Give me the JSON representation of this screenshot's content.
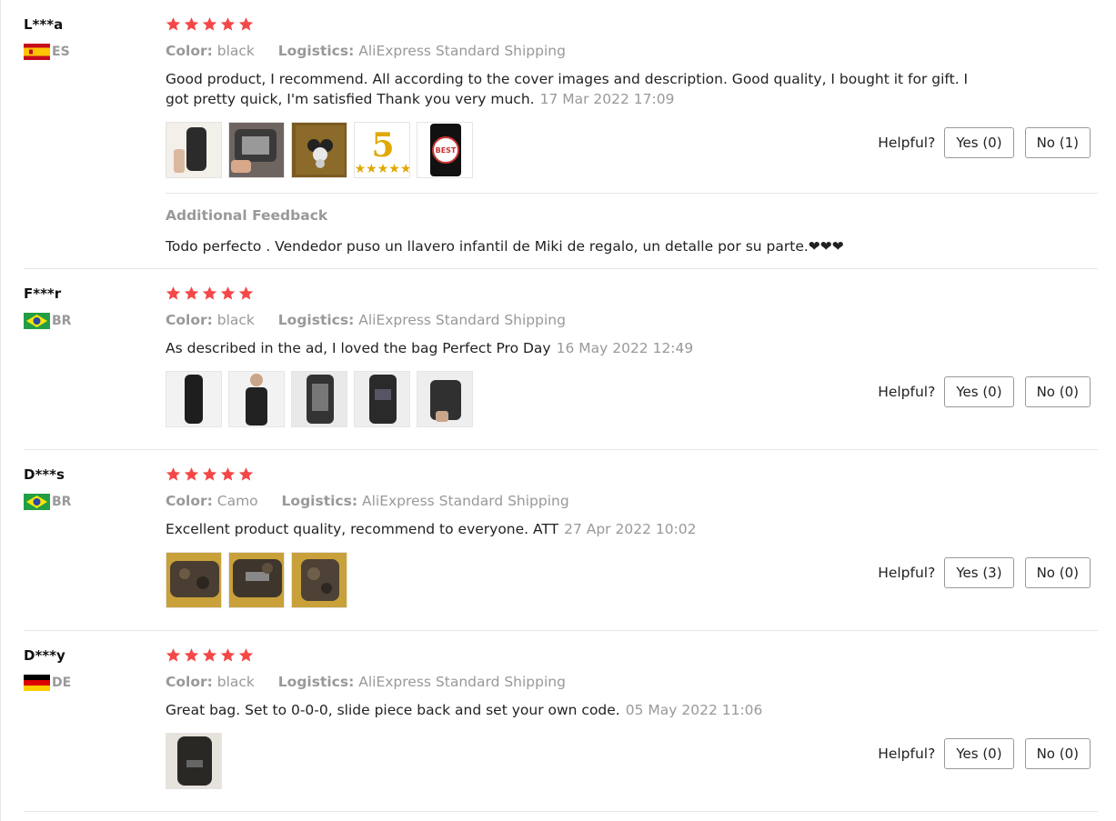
{
  "helpful_label": "Helpful?",
  "labels": {
    "color": "Color:",
    "logistics": "Logistics:"
  },
  "colors": {
    "star": "#f44848",
    "muted": "#999999",
    "text": "#222222",
    "divider": "#e6e6e6"
  },
  "reviews": [
    {
      "user": "L***a",
      "country": "ES",
      "flag": "spain-flag-icon",
      "rating": 5,
      "color": "black",
      "logistics": "AliExpress Standard Shipping",
      "text": "Good product, I recommend. All according to the cover images and description. Good quality, I bought it for gift. I got pretty quick, I'm satisfied Thank you very much.",
      "date": "17 Mar 2022 17:09",
      "photos": 5,
      "yes": "Yes (0)",
      "no": "No (1)",
      "additional_feedback": {
        "title": "Additional Feedback",
        "text": "Todo perfecto . Vendedor puso un llavero infantil de Miki de regalo, un detalle por su parte.❤❤❤"
      }
    },
    {
      "user": "F***r",
      "country": "BR",
      "flag": "brazil-flag-icon",
      "rating": 5,
      "color": "black",
      "logistics": "AliExpress Standard Shipping",
      "text": "As described in the ad, I loved the bag Perfect Pro Day",
      "date": "16 May 2022 12:49",
      "photos": 5,
      "yes": "Yes (0)",
      "no": "No (0)"
    },
    {
      "user": "D***s",
      "country": "BR",
      "flag": "brazil-flag-icon",
      "rating": 5,
      "color": "Camo",
      "logistics": "AliExpress Standard Shipping",
      "text": "Excellent product quality, recommend to everyone. ATT",
      "date": "27 Apr 2022 10:02",
      "photos": 3,
      "yes": "Yes (3)",
      "no": "No (0)"
    },
    {
      "user": "D***y",
      "country": "DE",
      "flag": "germany-flag-icon",
      "rating": 5,
      "color": "black",
      "logistics": "AliExpress Standard Shipping",
      "text": "Great bag. Set to 0-0-0, slide piece back and set your own code.",
      "date": "05 May 2022 11:06",
      "photos": 1,
      "yes": "Yes (0)",
      "no": "No (0)"
    }
  ]
}
